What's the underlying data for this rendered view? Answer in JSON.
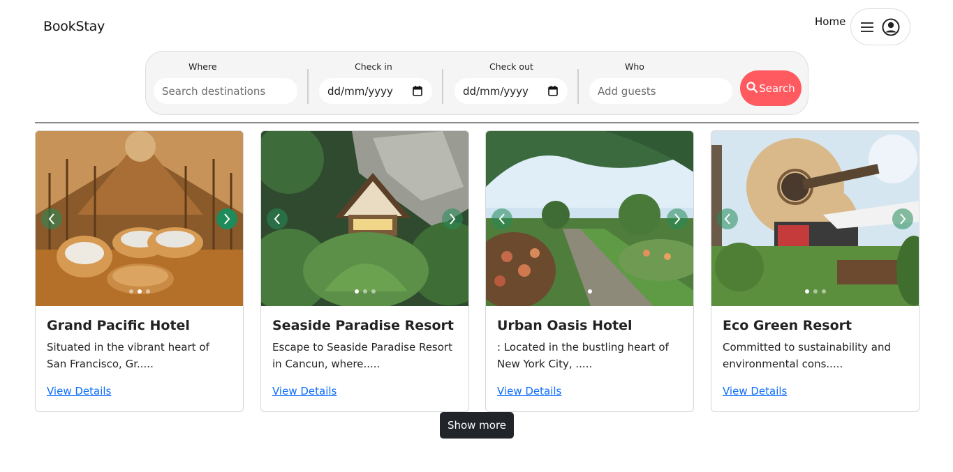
{
  "brand": "BookStay",
  "nav": {
    "home": "Home",
    "menu_icon": "hamburger-icon",
    "account_icon": "user-circle-icon"
  },
  "search": {
    "where": {
      "label": "Where",
      "placeholder": "Search destinations"
    },
    "checkin": {
      "label": "Check in",
      "value": "dd/mm/yyyy"
    },
    "checkout": {
      "label": "Check out",
      "value": "dd/mm/yyyy"
    },
    "who": {
      "label": "Who",
      "placeholder": "Add guests"
    },
    "button": "Search",
    "button_color": "#ff5a5f"
  },
  "hotels": [
    {
      "title": "Grand Pacific Hotel",
      "desc": "Situated in the vibrant heart of San Francisco, Gr.....",
      "link": "View Details",
      "image": "bamboo interior lounge",
      "dots": 3,
      "active_dot": 1
    },
    {
      "title": "Seaside Paradise Resort",
      "desc": "Escape to Seaside Paradise Resort in Cancun, where.....",
      "link": "View Details",
      "image": "jungle cabin below cliff",
      "dots": 3,
      "active_dot": 0
    },
    {
      "title": "Urban Oasis Hotel",
      "desc": ": Located in the bustling heart of New York City, .....",
      "link": "View Details",
      "image": "garden path with palms",
      "dots": 1,
      "active_dot": 0
    },
    {
      "title": "Eco Green Resort",
      "desc": "Committed to sustainability and environmental cons.....",
      "link": "View Details",
      "image": "guitar shaped building",
      "dots": 3,
      "active_dot": 0
    }
  ],
  "show_more": "Show more",
  "colors": {
    "accent": "#ff5a5f",
    "link": "#0d6efd",
    "dark_button": "#212529",
    "carousel_arrow": "#1f8a5a"
  }
}
